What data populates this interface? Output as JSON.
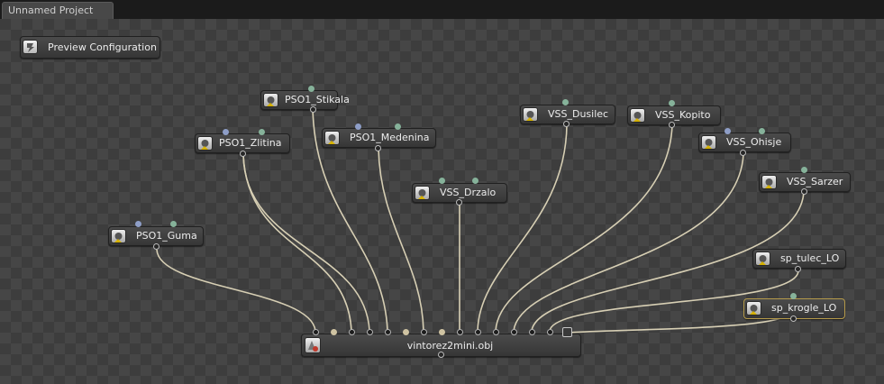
{
  "tab": {
    "title": "Unnamed Project"
  },
  "preview": {
    "label": "Preview Configuration"
  },
  "nodes": {
    "stikala": "PSO1_Stikala",
    "zlitina": "PSO1_Zlitina",
    "medenina": "PSO1_Medenina",
    "guma": "PSO1_Guma",
    "drzalo": "VSS_Drzalo",
    "dusilec": "VSS_Dusilec",
    "kopito": "VSS_Kopito",
    "ohisje": "VSS_Ohisje",
    "sarzer": "VSS_Sarzer",
    "tulec": "sp_tulec_LO",
    "krogle": "sp_krogle_LO"
  },
  "target": {
    "label": "vintorez2mini.obj"
  },
  "icons": {
    "preview": "config-icon",
    "material": "material-icon",
    "object": "object-icon"
  },
  "colors": {
    "wire": "#d7cfb4",
    "canvas": "#3d3d3d",
    "selected_border": "#b59a4a"
  }
}
